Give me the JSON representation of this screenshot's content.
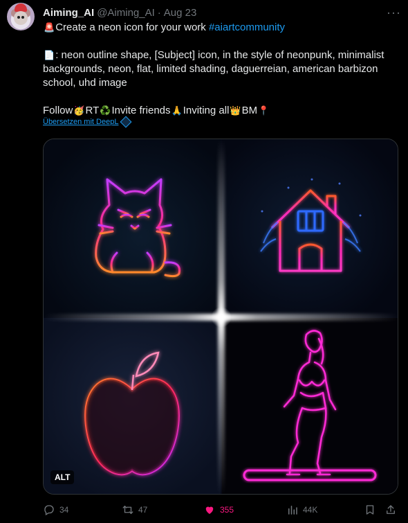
{
  "author": {
    "name": "Aiming_AI",
    "handle": "@Aiming_AI",
    "separator": "·",
    "date": "Aug 23"
  },
  "more_label": "···",
  "tweet": {
    "line1_emoji": "🚨",
    "line1_text": "Create a neon icon for your work ",
    "hashtag": "#aiartcommunity",
    "line2_emoji": "📄",
    "line2_text": ": neon outline shape, [Subject] icon, in the style of neonpunk, minimalist backgrounds, neon, flat, limited shading, daguerreian, american barbizon school, uhd image",
    "line3": [
      {
        "text": "Follow",
        "emoji": "🥳"
      },
      {
        "text": "RT",
        "emoji": "♻️"
      },
      {
        "text": "Invite friends",
        "emoji": "🙏"
      },
      {
        "text": "Inviting all",
        "emoji": "👑"
      },
      {
        "text": "BM",
        "emoji": "📍"
      }
    ]
  },
  "translate_label": "Übersetzen mit DeepL",
  "media": {
    "alt_badge": "ALT",
    "icons": [
      "cat-icon",
      "house-icon",
      "apple-icon",
      "woman-icon"
    ]
  },
  "actions": {
    "replies": "34",
    "retweets": "47",
    "likes": "355",
    "views": "44K"
  },
  "colors": {
    "accent": "#1d9bf0",
    "like": "#f91880",
    "muted": "#71767b",
    "neon_pink": "#ff2bd6",
    "neon_blue": "#2f6bff"
  }
}
